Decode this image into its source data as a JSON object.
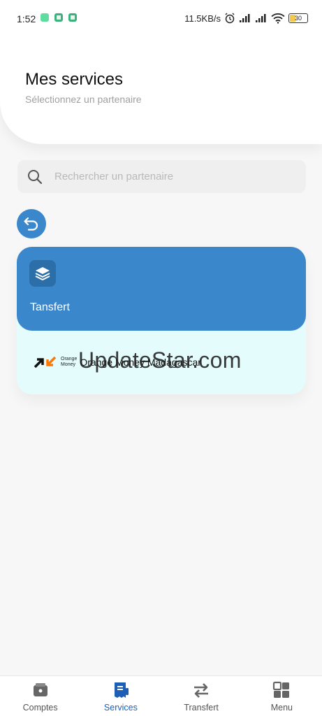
{
  "status_bar": {
    "time": "1:52",
    "network_speed": "11.5KB/s",
    "battery": "30",
    "icons": [
      "app-notification-icon",
      "app-notification-icon",
      "app-notification-icon",
      "alarm-icon",
      "signal-icon",
      "signal-icon",
      "wifi-icon",
      "battery-icon"
    ]
  },
  "header": {
    "title": "Mes services",
    "subtitle": "Sélectionnez un partenaire"
  },
  "search": {
    "placeholder": "Rechercher un partenaire",
    "icon": "search-icon"
  },
  "back_button": {
    "icon": "back-arrow-icon"
  },
  "service_card": {
    "title": "Tansfert",
    "icon": "layers-icon",
    "partners": [
      {
        "logo_text_line1": "Orange",
        "logo_text_line2": "Money",
        "name": "Orange Money Madagascar"
      }
    ]
  },
  "watermark": "UpdateStar.com",
  "bottom_nav": {
    "items": [
      {
        "label": "Comptes",
        "icon": "wallet-icon",
        "active": false
      },
      {
        "label": "Services",
        "icon": "receipt-icon",
        "active": true
      },
      {
        "label": "Transfert",
        "icon": "transfer-arrows-icon",
        "active": false
      },
      {
        "label": "Menu",
        "icon": "grid-menu-icon",
        "active": false
      }
    ]
  },
  "colors": {
    "primary": "#3a87cc",
    "primary_dark": "#2c6ea8",
    "active_nav": "#1d5fb7",
    "card_light": "#e5fcfc",
    "orange": "#ff7900"
  }
}
